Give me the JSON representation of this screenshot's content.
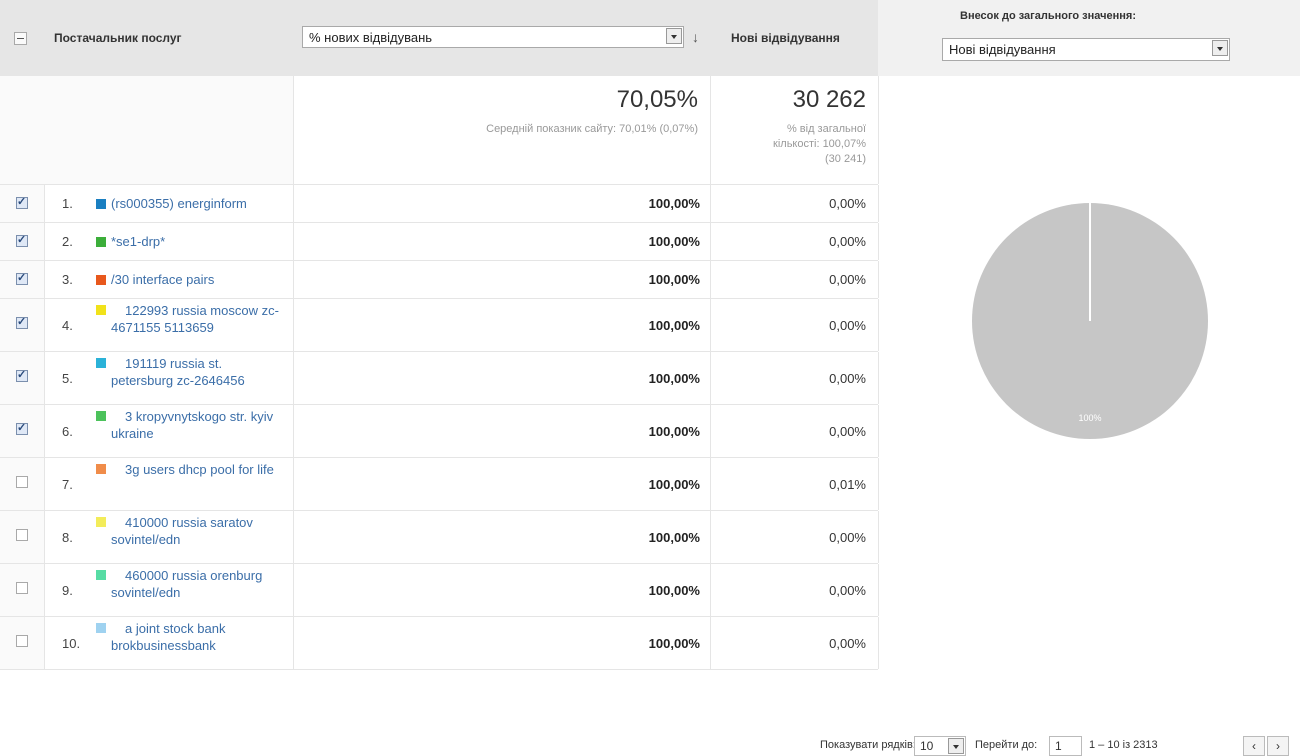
{
  "header": {
    "dimension_label": "Постачальник послуг",
    "metric_select_value": "% нових відвідувань",
    "sort_arrow": "↓",
    "new_visits_label": "Нові відвідування",
    "contribution_label": "Внесок до загального значення:",
    "contribution_select_value": "Нові відвідування"
  },
  "totals": {
    "metric_value": "70,05%",
    "metric_note": "Середній показник сайту: 70,01% (0,07%)",
    "new_visits_value": "30 262",
    "new_visits_note_1": "% від загальної",
    "new_visits_note_2": "кількості: 100,07%",
    "new_visits_note_3": "(30 241)"
  },
  "rows": [
    {
      "index": "1.",
      "name": "(rs000355) energinform",
      "metric": "100,00%",
      "new_visits": "0,00%",
      "checked": true,
      "color": "#1a7fc1"
    },
    {
      "index": "2.",
      "name": "*se1-drp*",
      "metric": "100,00%",
      "new_visits": "0,00%",
      "checked": true,
      "color": "#3cae3a"
    },
    {
      "index": "3.",
      "name": "/30 interface pairs",
      "metric": "100,00%",
      "new_visits": "0,00%",
      "checked": true,
      "color": "#e8581c"
    },
    {
      "index": "4.",
      "name": "122993 russia moscow zc-4671155 5113659",
      "metric": "100,00%",
      "new_visits": "0,00%",
      "checked": true,
      "color": "#f1e21a"
    },
    {
      "index": "5.",
      "name": "191119 russia st. petersburg zc-2646456",
      "metric": "100,00%",
      "new_visits": "0,00%",
      "checked": true,
      "color": "#2bb2d8"
    },
    {
      "index": "6.",
      "name": "3 kropyvnytskogo str. kyiv ukraine",
      "metric": "100,00%",
      "new_visits": "0,00%",
      "checked": true,
      "color": "#4cc25b"
    },
    {
      "index": "7.",
      "name": "3g users dhcp pool for life",
      "metric": "100,00%",
      "new_visits": "0,01%",
      "checked": false,
      "color": "#f08c4a"
    },
    {
      "index": "8.",
      "name": "410000 russia saratov sovintel/edn",
      "metric": "100,00%",
      "new_visits": "0,00%",
      "checked": false,
      "color": "#f3ec5a"
    },
    {
      "index": "9.",
      "name": "460000 russia orenburg sovintel/edn",
      "metric": "100,00%",
      "new_visits": "0,00%",
      "checked": false,
      "color": "#57dca4"
    },
    {
      "index": "10.",
      "name": "a joint stock bank brokbusinessbank",
      "metric": "100,00%",
      "new_visits": "0,00%",
      "checked": false,
      "color": "#9fd2f0"
    }
  ],
  "chart_data": {
    "type": "pie",
    "slices": [
      {
        "value": 100,
        "label": "100%",
        "color": "#c6c6c6"
      }
    ],
    "title": ""
  },
  "footer": {
    "rows_label": "Показувати рядків:",
    "rows_value": "10",
    "goto_label": "Перейти до:",
    "goto_value": "1",
    "range_text": "1 – 10 із 2313",
    "prev": "‹",
    "next": "›"
  }
}
